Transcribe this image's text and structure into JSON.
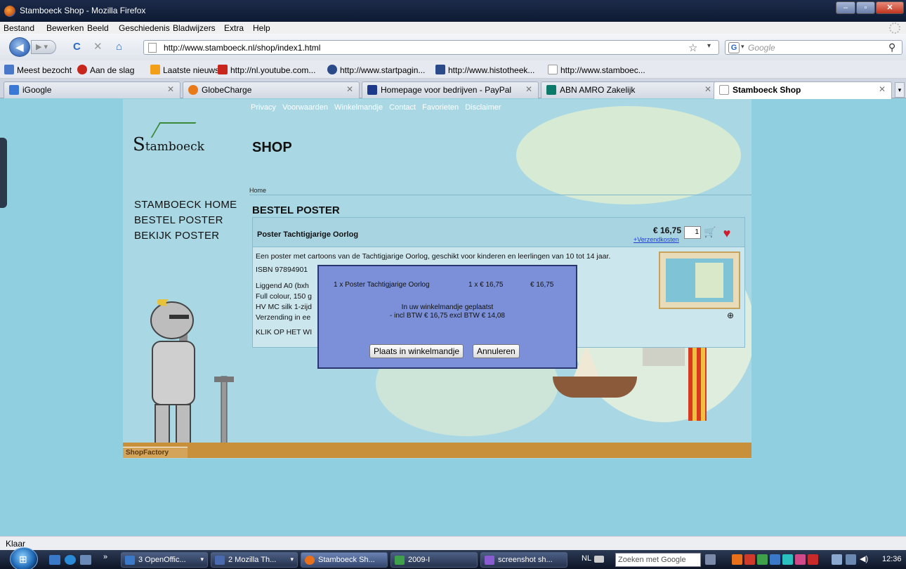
{
  "window": {
    "title": "Stamboeck Shop - Mozilla Firefox"
  },
  "menu": [
    "Bestand",
    "Bewerken",
    "Beeld",
    "Geschiedenis",
    "Bladwijzers",
    "Extra",
    "Help"
  ],
  "nav": {
    "url": "http://www.stamboeck.nl/shop/index1.html",
    "search_placeholder": "Google"
  },
  "bookmarks": [
    {
      "label": "Meest bezocht",
      "color": "#4a78c8"
    },
    {
      "label": "Aan de slag",
      "color": "#c8261d"
    },
    {
      "label": "Laatste nieuws",
      "color": "#f2a01a"
    },
    {
      "label": "http://nl.youtube.com...",
      "color": "#c8261d"
    },
    {
      "label": "http://www.startpagin...",
      "color": "#2a4a8a"
    },
    {
      "label": "http://www.histotheek...",
      "color": "#2a4a8a"
    },
    {
      "label": "http://www.stamboec...",
      "color": "#ffffff"
    }
  ],
  "tabs": [
    {
      "label": "iGoogle",
      "color": "#3a78d8"
    },
    {
      "label": "GlobeCharge",
      "color": "#e87a1a"
    },
    {
      "label": "Homepage voor bedrijven - PayPal",
      "color": "#1d3a8a"
    },
    {
      "label": "ABN AMRO Zakelijk",
      "color": "#0c7a6a"
    },
    {
      "label": "Stamboeck Shop",
      "color": "#ffffff"
    }
  ],
  "site": {
    "topnav": [
      "Privacy",
      "Voorwaarden",
      "Winkelmandje",
      "Contact",
      "Favorieten",
      "Disclaimer"
    ],
    "logo_s": "S",
    "logo_rest": "tamboeck",
    "shop_title": "SHOP",
    "crumb": "Home",
    "leftnav": [
      "STAMBOECK HOME",
      "BESTEL POSTER",
      "BEKIJK POSTER"
    ],
    "heading": "BESTEL POSTER",
    "product": {
      "name": "Poster Tachtigjarige Oorlog",
      "price": "€ 16,75",
      "shipping_link": "+Verzendkosten",
      "qty": "1",
      "desc_lines": [
        "Een poster met cartoons van de Tachtigjarige Oorlog, geschikt voor kinderen en leerlingen van 10 tot 14 jaar.",
        "ISBN 97894901",
        "",
        "Liggend A0 (bxh",
        "Full colour, 150 g",
        "HV MC silk 1-zijd",
        "Verzending in ee",
        "",
        "KLIK OP HET WI"
      ]
    },
    "footer": "ShopFactory"
  },
  "dialog": {
    "item": "1 x Poster Tachtigjarige Oorlog",
    "unit": "1 x € 16,75",
    "total": "€ 16,75",
    "line1": "In uw winkelmandje geplaatst",
    "line2": "- incl BTW € 16,75 excl BTW € 14,08",
    "ok": "Plaats in winkelmandje",
    "cancel": "Annuleren"
  },
  "status": "Klaar",
  "taskbar": {
    "items": [
      {
        "label": "3 OpenOffic...",
        "color": "#3a78c8",
        "dropdown": true
      },
      {
        "label": "2 Mozilla Th...",
        "color": "#4a6ab0",
        "dropdown": true
      },
      {
        "label": "Stamboeck Sh...",
        "color": "#e8701a",
        "dropdown": false,
        "active": true
      },
      {
        "label": "2009-I",
        "color": "#3ea04a",
        "dropdown": false
      },
      {
        "label": "screenshot sh...",
        "color": "#8a5ad0",
        "dropdown": false
      }
    ],
    "lang": "NL",
    "search": "Zoeken met Google",
    "clock": "12:36"
  }
}
